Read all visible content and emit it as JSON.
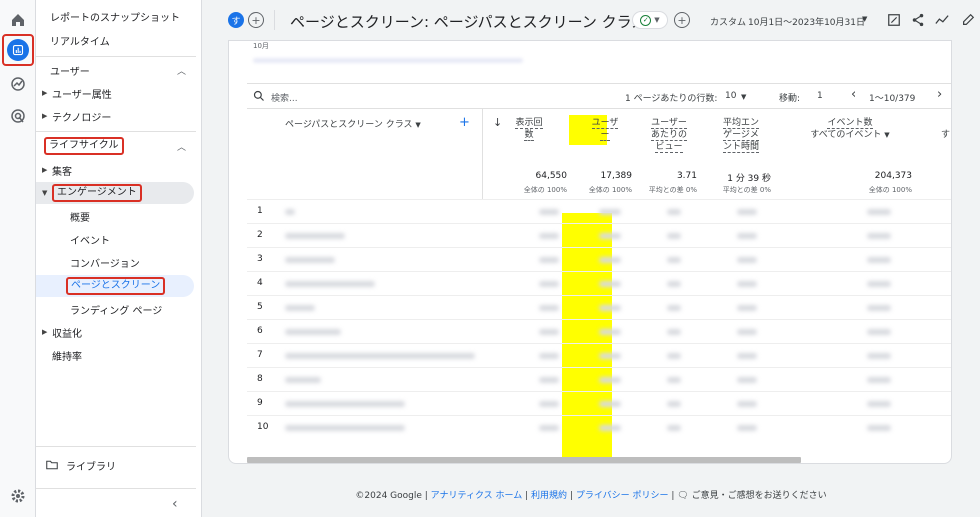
{
  "nav": {
    "snapshot": "レポートのスナップショット",
    "realtime": "リアルタイム",
    "users_section": "ユーザー",
    "user_attributes": "ユーザー属性",
    "technology": "テクノロジー",
    "lifecycle_section": "ライフサイクル",
    "acquisition": "集客",
    "engagement": "エンゲージメント",
    "overview": "概要",
    "events": "イベント",
    "conversions": "コンバージョン",
    "pages_screens": "ページとスクリーン",
    "landing_page": "ランディング ページ",
    "monetization": "収益化",
    "retention": "維持率",
    "library": "ライブラリ"
  },
  "header": {
    "avatar_letter": "す",
    "title": "ページとスクリーン: ページパスとスクリーン クラス",
    "date_prefix": "カスタム",
    "date_range": "10月1日～2023年10月31日"
  },
  "chart": {
    "axis_stub": "10月"
  },
  "toolbar": {
    "search_placeholder": "検索...",
    "rows_label": "1 ページあたりの行数:",
    "rows_value": "10",
    "goto_label": "移動:",
    "goto_value": "1",
    "range": "1～10/379"
  },
  "table": {
    "dimension_header": "ページパスとスクリーン クラス",
    "columns": [
      {
        "line1": "表示回",
        "line2": "数",
        "total": "64,550",
        "sub": "全体の 100%"
      },
      {
        "line1": "ユーザ",
        "line2": "ー",
        "total": "17,389",
        "sub": "全体の 100%"
      },
      {
        "line1": "ユーザー",
        "line2": "あたりの",
        "line3": "ビュー",
        "total": "3.71",
        "sub": "平均との差 0%"
      },
      {
        "line1": "平均エン",
        "line2": "ゲージメ",
        "line3": "ント時間",
        "total": "1 分 39 秒",
        "sub": "平均との差 0%"
      },
      {
        "line1": "イベント数",
        "line2": "すべてのイベント",
        "total": "204,373",
        "sub": "全体の 100%"
      }
    ],
    "row_numbers": [
      "1",
      "2",
      "3",
      "4",
      "5",
      "6",
      "7",
      "8",
      "9",
      "10"
    ]
  },
  "footer": {
    "copyright": "©2024 Google",
    "analytics_home": "アナリティクス ホーム",
    "terms": "利用規約",
    "privacy": "プライバシー ポリシー",
    "feedback": "ご意見・ご感想をお送りください"
  },
  "colors": {
    "accent": "#1a73e8",
    "highlight": "#ffff00",
    "annotation": "#d93025"
  }
}
